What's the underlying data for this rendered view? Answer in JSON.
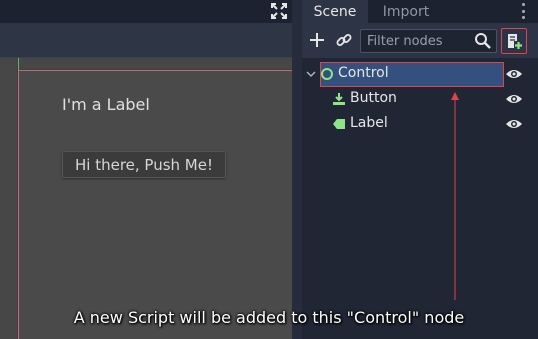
{
  "dock": {
    "tabs": [
      {
        "label": "Scene",
        "active": true
      },
      {
        "label": "Import",
        "active": false
      }
    ],
    "filter": {
      "placeholder": "Filter nodes",
      "value": ""
    },
    "icons": {
      "add": "plus-icon",
      "link": "link-icon",
      "search": "search-icon",
      "attach_script": "script-add-icon",
      "menu": "kebab-menu-icon"
    }
  },
  "tree": {
    "nodes": [
      {
        "label": "Control",
        "icon": "control-node-icon",
        "selected": true,
        "depth": 0,
        "visible": true
      },
      {
        "label": "Button",
        "icon": "button-node-icon",
        "selected": false,
        "depth": 1,
        "visible": true
      },
      {
        "label": "Label",
        "icon": "label-node-icon",
        "selected": false,
        "depth": 1,
        "visible": true
      }
    ]
  },
  "canvas": {
    "label_text": "I'm a Label",
    "button_text": "Hi there, Push Me!"
  },
  "annotation": {
    "caption": "A new Script will be added to this \"Control\" node",
    "highlight_color": "#e0434a"
  },
  "colors": {
    "selection": "#33507f",
    "control_icon": "#8ee486",
    "button_icon": "#8ee486",
    "label_icon": "#8ee486"
  }
}
